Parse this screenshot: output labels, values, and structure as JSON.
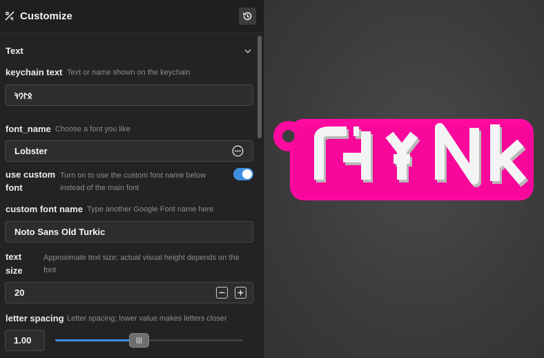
{
  "header": {
    "title": "Customize",
    "icon": "tools-icon",
    "history_icon": "history-icon"
  },
  "section": {
    "title": "Text",
    "icon": "chevron-down-icon"
  },
  "fields": {
    "keychain_text": {
      "label": "keychain text",
      "description": "Text or name shown on the keychain",
      "value": "𐰋𐰃𐰘𐰚"
    },
    "font_name": {
      "label": "font_name",
      "description": "Choose a font you like",
      "value": "Lobster",
      "icon": "more-options-icon"
    },
    "use_custom_font": {
      "label_line1": "use custom",
      "label_line2": "font",
      "description": "Turn on to use the custom font name below instead of the main font",
      "enabled": true
    },
    "custom_font_name": {
      "label": "custom font name",
      "description": "Type another Google Font name here",
      "value": "Noto Sans Old Turkic"
    },
    "text_size": {
      "label_line1": "text",
      "label_line2": "size",
      "description": "Approximate text size; actual visual height depends on the font",
      "value": "20",
      "minus_icon": "minus-icon",
      "plus_icon": "plus-icon"
    },
    "letter_spacing": {
      "label": "letter spacing",
      "description": "Letter spacing; lower value makes letters closer",
      "value": "1.00",
      "fraction": 0.45
    }
  },
  "colors": {
    "accent": "#3f8fe0",
    "keychain_base": "#ff0aa0",
    "keychain_text": "#f4f4f4"
  }
}
